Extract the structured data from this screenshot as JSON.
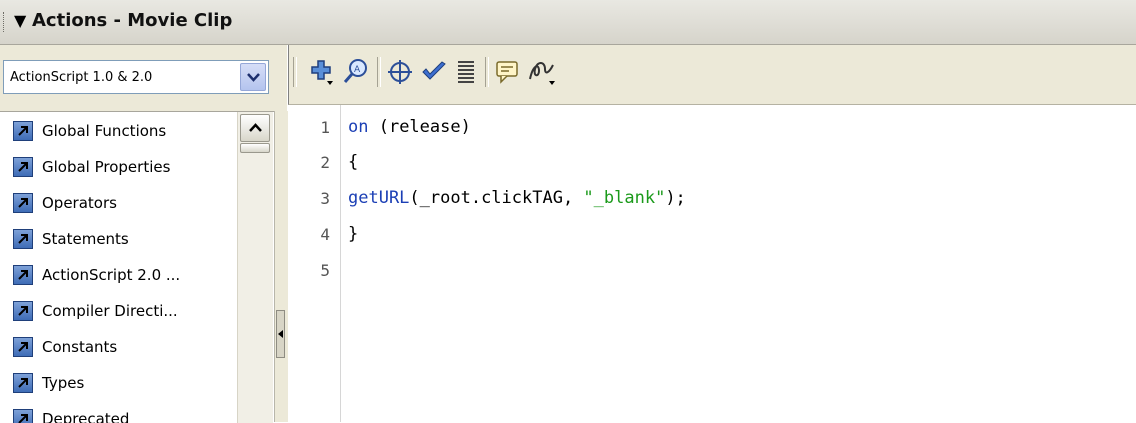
{
  "window": {
    "title": "Actions - Movie Clip",
    "collapse_arrow_icon": "triangle-down-icon"
  },
  "script_version": {
    "selected": "ActionScript 1.0 & 2.0"
  },
  "toolbox": {
    "items": [
      {
        "label": "Global Functions",
        "icon": "book-icon"
      },
      {
        "label": "Global Properties",
        "icon": "book-icon"
      },
      {
        "label": "Operators",
        "icon": "book-icon"
      },
      {
        "label": "Statements",
        "icon": "book-icon"
      },
      {
        "label": "ActionScript 2.0 ...",
        "icon": "book-icon"
      },
      {
        "label": "Compiler Directi...",
        "icon": "book-icon"
      },
      {
        "label": "Constants",
        "icon": "book-icon"
      },
      {
        "label": "Types",
        "icon": "book-icon"
      },
      {
        "label": "Deprecated",
        "icon": "book-icon"
      }
    ]
  },
  "toolbar": {
    "icons": [
      "add-item-icon",
      "find-icon",
      "target-icon",
      "check-syntax-icon",
      "auto-format-icon",
      "code-hint-icon",
      "debug-options-icon"
    ]
  },
  "editor": {
    "line_numbers": [
      "1",
      "2",
      "3",
      "4",
      "5"
    ],
    "lines": [
      {
        "keyword": "on",
        "rest": " (release)"
      },
      {
        "text": "{"
      },
      {
        "keyword": "getURL",
        "mid": "(_root.clickTAG, ",
        "string": "\"_blank\"",
        "end": ");"
      },
      {
        "text": "}"
      },
      {
        "text": ""
      }
    ]
  },
  "colors": {
    "keyword": "#1b3fb5",
    "string": "#1b9a1b",
    "panel": "#ece9d8"
  }
}
